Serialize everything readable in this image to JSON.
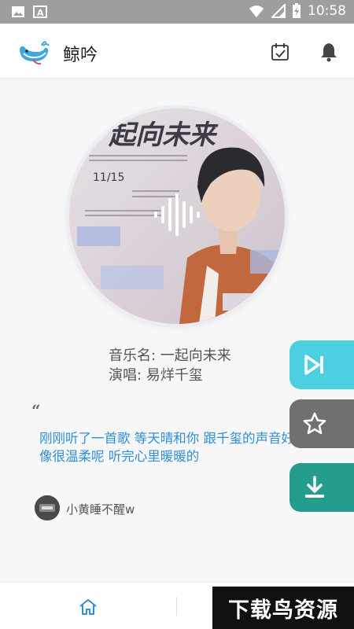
{
  "status_bar": {
    "time": "10:58",
    "icons": [
      "image-icon",
      "text-a-icon",
      "wifi-icon",
      "signal-icon",
      "battery-charging-icon"
    ]
  },
  "app_bar": {
    "title": "鲸吟",
    "logo_icon": "whale-logo-icon",
    "actions": [
      "calendar-check-icon",
      "bell-icon"
    ]
  },
  "cover": {
    "overlay_icon": "sound-wave-icon",
    "poster_text": "起向未来",
    "poster_date": "11/15"
  },
  "song": {
    "name_line": "音乐名: 一起向未来",
    "singer_line": "演唱: 易烊千玺"
  },
  "comment": {
    "quote_glyph": "“",
    "text": "刚刚听了一首歌 等天晴和你 跟千玺的声音好像很温柔呢 听完心里暖暖的",
    "user_name": "小黄睡不醒w"
  },
  "side_actions": [
    {
      "name": "next",
      "icon": "skip-next-icon",
      "color": "#4ccfe1"
    },
    {
      "name": "favorite",
      "icon": "star-outline-icon",
      "color": "#707070"
    },
    {
      "name": "download",
      "icon": "download-icon",
      "color": "#239d8d"
    }
  ],
  "bottom_nav": {
    "home_icon": "home-icon",
    "accent": "#2f8fd8"
  },
  "watermark": {
    "text": "下载鸟资源"
  }
}
